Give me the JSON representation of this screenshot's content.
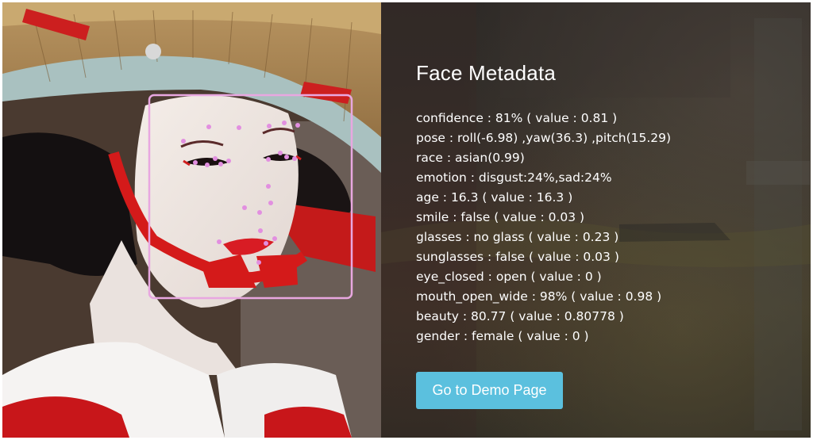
{
  "panel": {
    "title": "Face Metadata",
    "metadata": [
      "confidence : 81% ( value : 0.81 )",
      "pose : roll(-6.98) ,yaw(36.3) ,pitch(15.29)",
      "race : asian(0.99)",
      "emotion : disgust:24%,sad:24%",
      "age : 16.3 ( value : 16.3 )",
      "smile : false ( value : 0.03 )",
      "glasses : no glass ( value : 0.23 )",
      "sunglasses : false ( value : 0.03 )",
      "eye_closed : open ( value : 0 )",
      "mouth_open_wide : 98% ( value : 0.98 )",
      "beauty : 80.77 ( value : 0.80778 )",
      "gender : female ( value : 0 )"
    ],
    "demo_button_label": "Go to Demo Page"
  },
  "colors": {
    "accent_button": "#5bc0de",
    "face_box": "#e8a7e0",
    "landmark": "#e28fe0"
  }
}
